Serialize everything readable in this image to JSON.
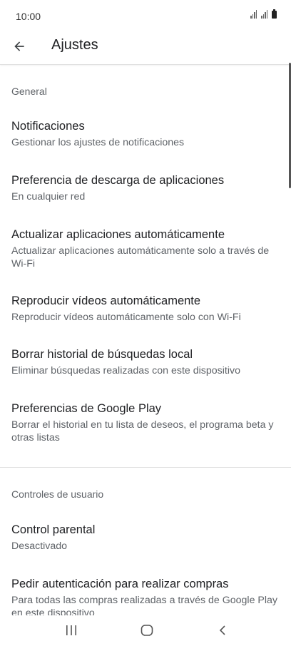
{
  "status_bar": {
    "time": "10:00"
  },
  "app_bar": {
    "title": "Ajustes"
  },
  "sections": {
    "general": {
      "header": "General"
    },
    "user_controls": {
      "header": "Controles de usuario"
    }
  },
  "items": [
    {
      "title": "Notificaciones",
      "subtitle": "Gestionar los ajustes de notificaciones"
    },
    {
      "title": "Preferencia de descarga de aplicaciones",
      "subtitle": "En cualquier red"
    },
    {
      "title": "Actualizar aplicaciones automáticamente",
      "subtitle": "Actualizar aplicaciones automáticamente solo a través de Wi-Fi"
    },
    {
      "title": "Reproducir vídeos automáticamente",
      "subtitle": "Reproducir vídeos automáticamente solo con Wi-Fi"
    },
    {
      "title": "Borrar historial de búsquedas local",
      "subtitle": "Eliminar búsquedas realizadas con este dispositivo"
    },
    {
      "title": "Preferencias de Google Play",
      "subtitle": "Borrar el historial en tu lista de deseos, el programa beta y otras listas"
    },
    {
      "title": "Control parental",
      "subtitle": "Desactivado"
    },
    {
      "title": "Pedir autenticación para realizar compras",
      "subtitle": "Para todas las compras realizadas a través de Google Play en este dispositivo"
    }
  ],
  "icons": {
    "back": "arrow-left-icon",
    "recents": "recent-apps-icon",
    "home": "home-icon",
    "nav_back": "chevron-left-icon"
  }
}
